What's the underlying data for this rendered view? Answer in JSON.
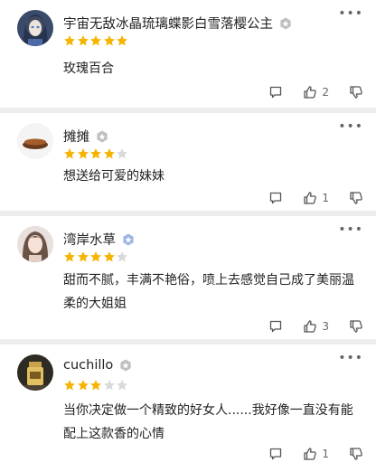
{
  "reviews": [
    {
      "username": "宇宙无敌冰晶琉璃蝶影白雪落樱公主",
      "rating": 5,
      "text": "玫瑰百合",
      "likes": "2",
      "avatar": "anime-girl-avatar"
    },
    {
      "username": "摊摊",
      "rating": 4,
      "text": "想送给可爱的妹妹",
      "likes": "1",
      "avatar": "cake-avatar"
    },
    {
      "username": "湾岸水草",
      "rating": 4,
      "text": "甜而不腻，丰满不艳俗，喷上去感觉自己成了美丽温柔的大姐姐",
      "likes": "3",
      "avatar": "girl-photo-avatar"
    },
    {
      "username": "cuchillo",
      "rating": 3,
      "text": "当你决定做一个精致的好女人......我好像一直没有能配上这款香的心情",
      "likes": "1",
      "avatar": "bottle-avatar"
    }
  ],
  "colors": {
    "star_on": "#f5b400",
    "star_off": "#d9d9d9",
    "badge": "#bfbfbf",
    "badge_blue": "#9fb5e6"
  }
}
